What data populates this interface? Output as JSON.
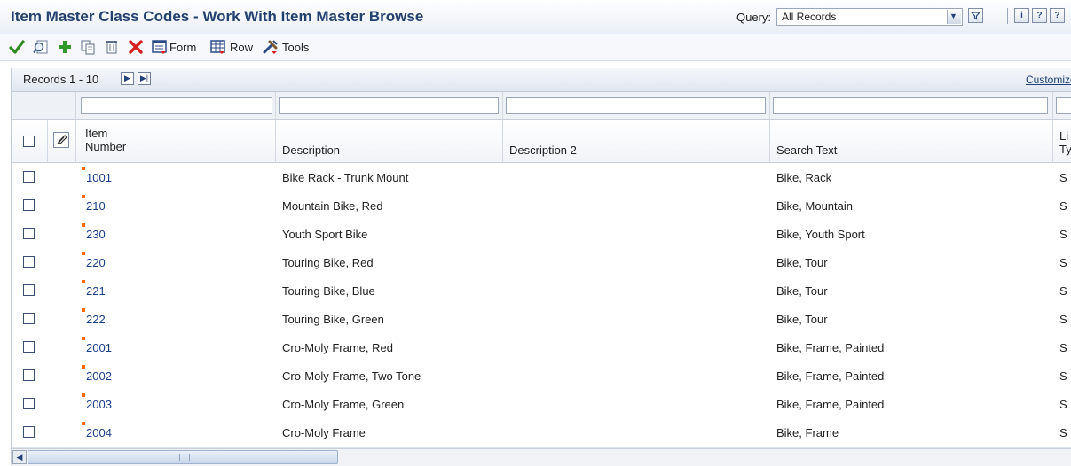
{
  "window": {
    "title": "Item Master Class Codes - Work With Item Master Browse"
  },
  "query": {
    "label": "Query:",
    "value": "All Records"
  },
  "header_buttons": {
    "filter": "▽",
    "info": "i",
    "help": "?",
    "about": "?"
  },
  "toolbar": {
    "form_label": "Form",
    "row_label": "Row",
    "tools_label": "Tools",
    "colors": {
      "ok": "#2e8b1f",
      "add": "#2f9a2a",
      "delete": "#d62020"
    }
  },
  "grid": {
    "records_label": "Records 1 - 10",
    "customize_label": "Customize",
    "columns": {
      "item_number_line1": "Item",
      "item_number_line2": "Number",
      "description": "Description",
      "description2": "Description 2",
      "search_text": "Search Text",
      "line_type_line1": "Li",
      "line_type_line2": "Ty"
    },
    "rows": [
      {
        "item": "1001",
        "description": "Bike Rack - Trunk Mount",
        "description2": "",
        "search": "Bike, Rack",
        "line_type": "S"
      },
      {
        "item": "210",
        "description": "Mountain Bike, Red",
        "description2": "",
        "search": "Bike, Mountain",
        "line_type": "S"
      },
      {
        "item": "230",
        "description": "Youth Sport Bike",
        "description2": "",
        "search": "Bike, Youth Sport",
        "line_type": "S"
      },
      {
        "item": "220",
        "description": "Touring Bike, Red",
        "description2": "",
        "search": "Bike, Tour",
        "line_type": "S"
      },
      {
        "item": "221",
        "description": "Touring Bike, Blue",
        "description2": "",
        "search": "Bike, Tour",
        "line_type": "S"
      },
      {
        "item": "222",
        "description": "Touring Bike, Green",
        "description2": "",
        "search": "Bike, Tour",
        "line_type": "S"
      },
      {
        "item": "2001",
        "description": "Cro-Moly Frame, Red",
        "description2": "",
        "search": "Bike, Frame, Painted",
        "line_type": "S"
      },
      {
        "item": "2002",
        "description": "Cro-Moly Frame, Two Tone",
        "description2": "",
        "search": "Bike, Frame, Painted",
        "line_type": "S"
      },
      {
        "item": "2003",
        "description": "Cro-Moly Frame, Green",
        "description2": "",
        "search": "Bike, Frame, Painted",
        "line_type": "S"
      },
      {
        "item": "2004",
        "description": "Cro-Moly Frame",
        "description2": "",
        "search": "Bike, Frame",
        "line_type": "S"
      }
    ]
  }
}
